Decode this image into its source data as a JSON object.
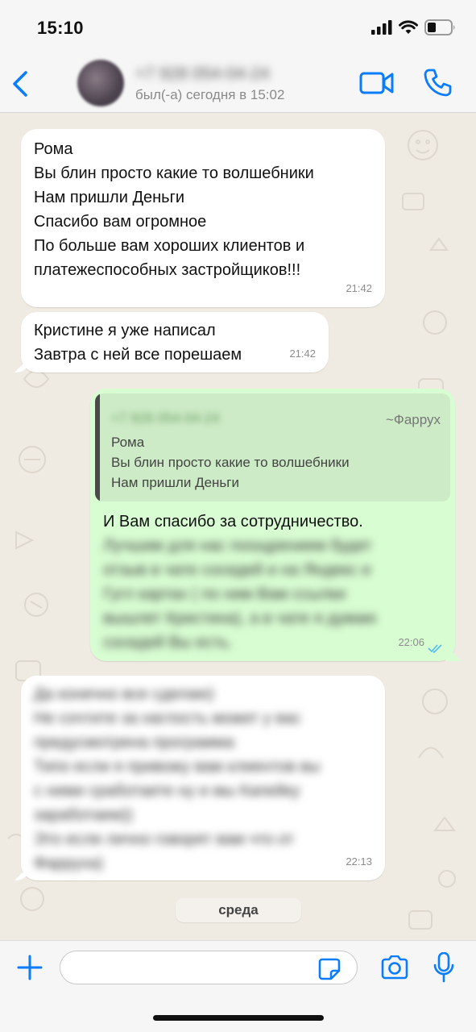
{
  "status_bar": {
    "time": "15:10",
    "icons": [
      "signal-icon",
      "wifi-icon",
      "battery-icon"
    ]
  },
  "header": {
    "contact_name": "+7 928 054-04-24",
    "contact_status": "был(-а) сегодня в 15:02",
    "icons": [
      "back-chevron-icon",
      "video-camera-icon",
      "phone-icon"
    ],
    "accent_color": "#0a7cff"
  },
  "messages": [
    {
      "direction": "incoming",
      "lines": [
        "Рома",
        "Вы блин просто какие то волшебники",
        "Нам пришли Деньги",
        "Спасибо вам огромное",
        "По больше вам хороших клиентов и",
        "платежеспособных застройщиков!!!"
      ],
      "time": "21:42"
    },
    {
      "direction": "incoming",
      "lines": [
        "Кристине я уже написал",
        "Завтра с ней все порешаем"
      ],
      "time": "21:42"
    },
    {
      "direction": "outgoing",
      "quote": {
        "phone": "+7 928 054-04-24",
        "author": "~Фаррух",
        "lines": [
          "Рома",
          "Вы блин просто какие то волшебники",
          "Нам пришли Деньги"
        ]
      },
      "text": "И Вам спасибо за сотрудничество.",
      "blurred_lines": [
        "Лучшим для нас поощрением будет",
        "отзыв в чате соседей и на Яндекс и",
        "Гугл картах ( по ним Вам ссылки",
        "вышлет Кристина), а в чате я думаю",
        "соседей Вы есть."
      ],
      "time": "22:06",
      "read_icon": "double-check-icon"
    },
    {
      "direction": "incoming",
      "blurred_lines": [
        "Да конечно все сделаю)",
        "Не сочтите за наглость может у вас",
        "предусмотрена программа",
        "Типо если я привожу вам клиентов вы",
        "с ними сработаете ну и мы Капейку",
        "заработаем))",
        "Это если лично говорят вам что от",
        "Фаррухa)"
      ],
      "time": "22:13"
    }
  ],
  "day_separator": "среда",
  "input_bar": {
    "placeholder": "",
    "icons": [
      "plus-icon",
      "sticker-icon",
      "camera-icon",
      "microphone-icon"
    ]
  }
}
